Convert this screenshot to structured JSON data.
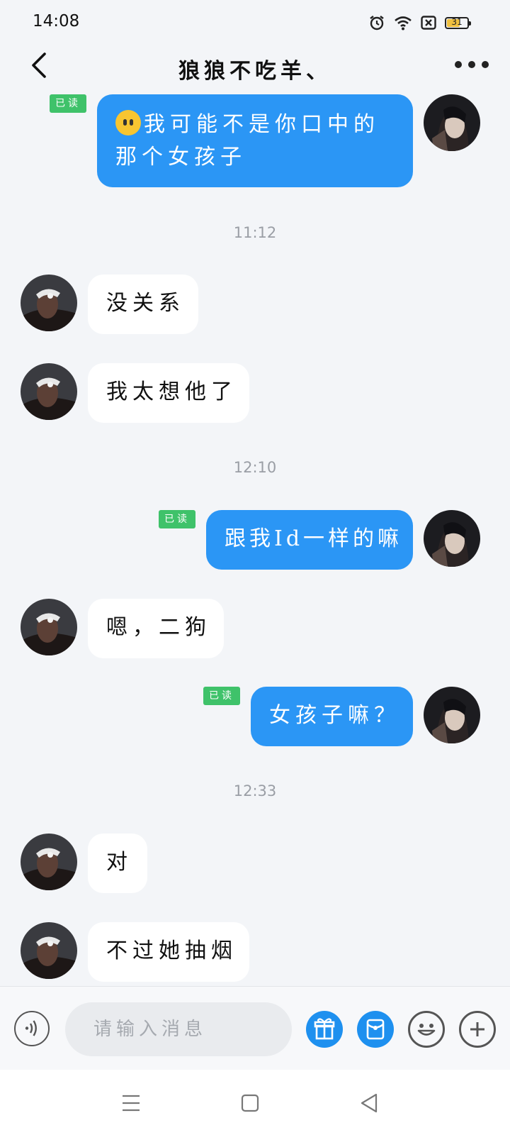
{
  "status_bar": {
    "time": "14:08",
    "battery": "31"
  },
  "header": {
    "title": "狼狼不吃羊、",
    "back_icon": "chevron-left-icon",
    "more_icon": "more-icon"
  },
  "colors": {
    "outgoing_bubble": "#2b96f5",
    "incoming_bubble": "#ffffff",
    "read_badge": "#3fc26a",
    "background": "#f3f5f8"
  },
  "messages": [
    {
      "dir": "out",
      "text": "我可能不是你口中的那个女孩子",
      "line1": "我可能不是你口中的",
      "line2": "那个女孩子",
      "emoji": "neutral-face",
      "read": "已读"
    },
    {
      "type": "timestamp",
      "text": "11:12"
    },
    {
      "dir": "in",
      "text": "没关系"
    },
    {
      "dir": "in",
      "text": "我太想他了"
    },
    {
      "type": "timestamp",
      "text": "12:10"
    },
    {
      "dir": "out",
      "text": "跟我Id一样的嘛",
      "read": "已读"
    },
    {
      "dir": "in",
      "text": "嗯，二狗"
    },
    {
      "dir": "out",
      "text": "女孩子嘛？",
      "read": "已读"
    },
    {
      "type": "timestamp",
      "text": "12:33"
    },
    {
      "dir": "in",
      "text": "对"
    },
    {
      "dir": "in",
      "text": "不过她抽烟"
    }
  ],
  "input_bar": {
    "placeholder": "请输入消息"
  }
}
